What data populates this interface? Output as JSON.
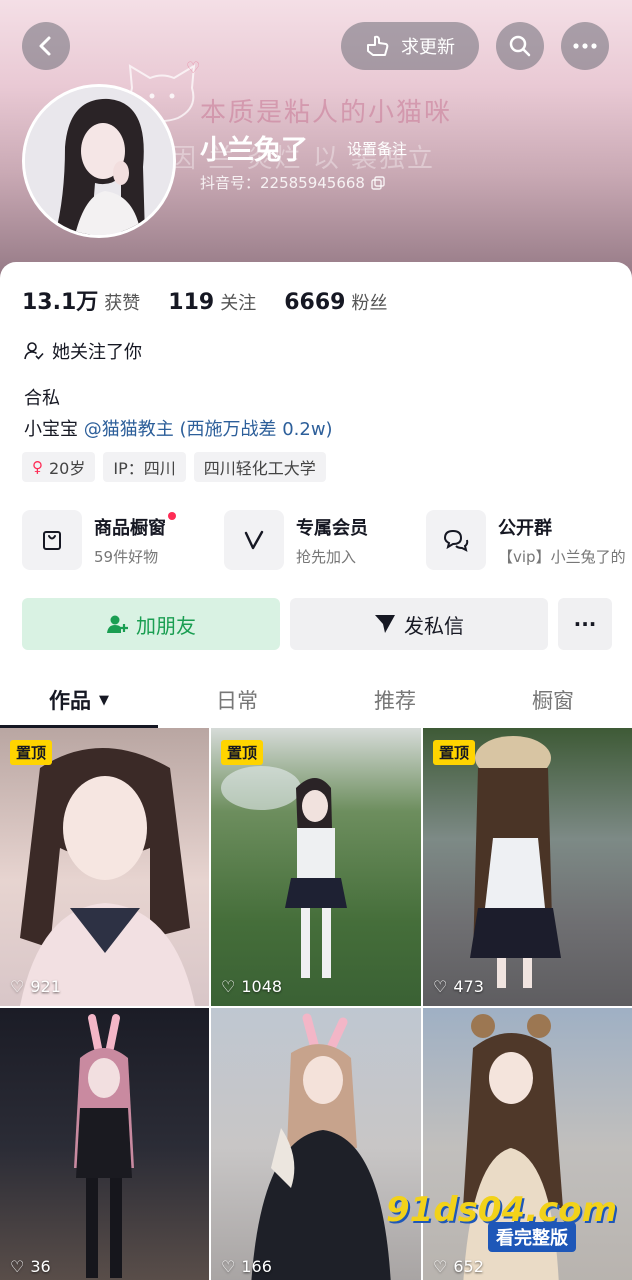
{
  "header": {
    "update_label": "求更新",
    "deco_text_1": "本质是粘人的小猫咪",
    "deco_text_2": "因  兰  炎烂  以  装独立"
  },
  "profile": {
    "nickname": "小兰兔了",
    "remark_label": "设置备注",
    "douyin_id": "抖音号：22585945668"
  },
  "stats": [
    {
      "num": "13.1万",
      "label": "获赞"
    },
    {
      "num": "119",
      "label": "关注"
    },
    {
      "num": "6669",
      "label": "粉丝"
    }
  ],
  "follows_you": "她关注了你",
  "bio": {
    "line1": "合私",
    "line2_prefix": "小宝宝",
    "line2_mention": "@猫猫教主 (西施万战差 0.2w)"
  },
  "tags": [
    {
      "label": "20岁"
    },
    {
      "label": "IP：四川"
    },
    {
      "label": "四川轻化工大学"
    }
  ],
  "services": [
    {
      "title": "商品橱窗",
      "sub": "59件好物"
    },
    {
      "title": "专属会员",
      "sub": "抢先加入"
    },
    {
      "title": "公开群",
      "sub": "【vip】小兰兔了的"
    }
  ],
  "actions": {
    "add_friend": "加朋友",
    "message": "发私信",
    "more": "···"
  },
  "tabs": [
    {
      "label": "作品"
    },
    {
      "label": "日常"
    },
    {
      "label": "推荐"
    },
    {
      "label": "橱窗"
    }
  ],
  "videos": [
    {
      "pinned": "置顶",
      "likes": "921"
    },
    {
      "pinned": "置顶",
      "likes": "1048"
    },
    {
      "pinned": "置顶",
      "likes": "473"
    },
    {
      "pinned": "",
      "likes": "36"
    },
    {
      "pinned": "",
      "likes": "166"
    },
    {
      "pinned": "",
      "likes": "652"
    }
  ],
  "watermark": {
    "line1": "91ds04.com",
    "line2": "看完整版"
  },
  "colors": {
    "accent_red": "#fe2c55",
    "add_friend_green": "#1a9e52",
    "mention_blue": "#2d5f9a",
    "pin_yellow": "#ffd400"
  }
}
